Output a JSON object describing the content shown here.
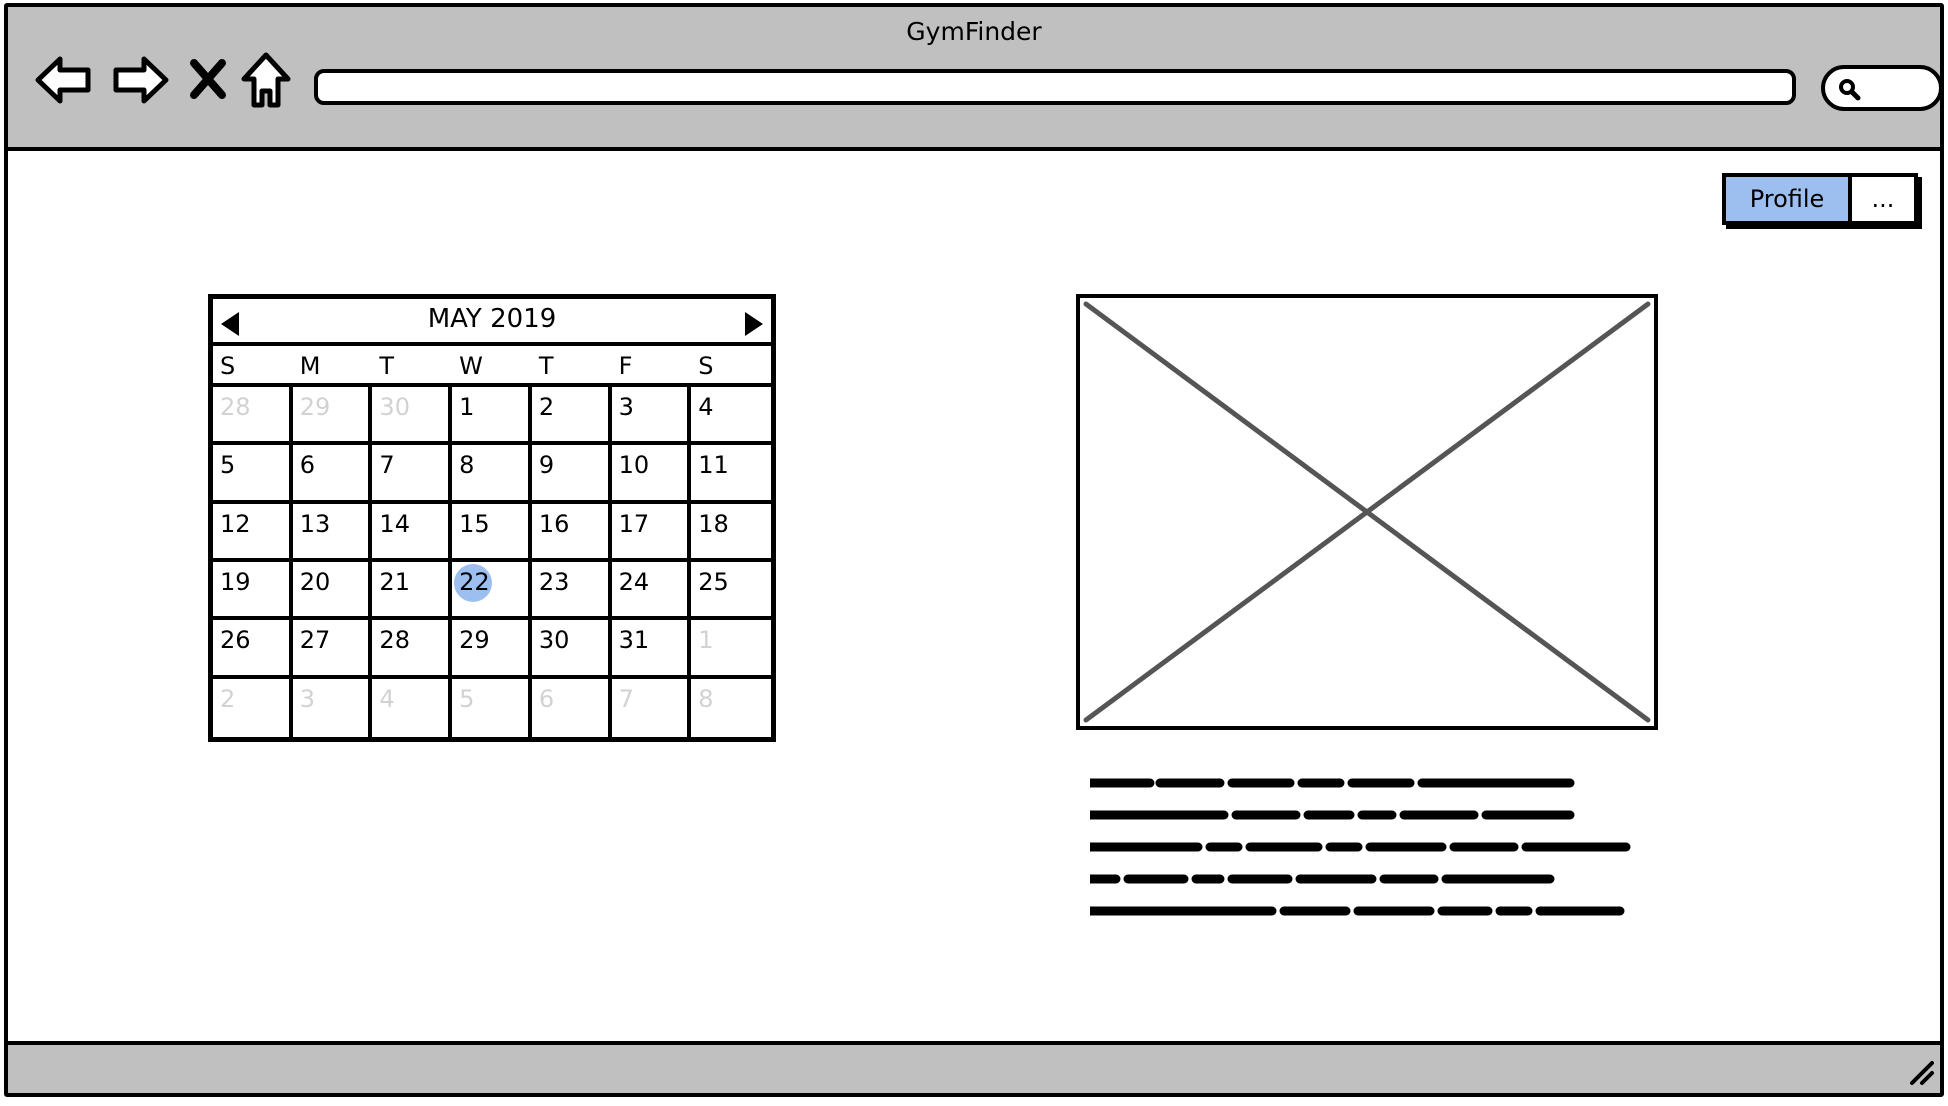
{
  "window": {
    "title": "GymFinder"
  },
  "toolbar": {
    "back_icon": "back-arrow-icon",
    "forward_icon": "forward-arrow-icon",
    "stop_icon": "close-icon",
    "home_icon": "home-icon",
    "url_value": "",
    "search_icon": "search-icon"
  },
  "header": {
    "profile_label": "Profile",
    "more_label": "..."
  },
  "calendar": {
    "month_label": "MAY 2019",
    "weekdays": [
      "S",
      "M",
      "T",
      "W",
      "T",
      "F",
      "S"
    ],
    "days": [
      {
        "n": "28",
        "muted": true
      },
      {
        "n": "29",
        "muted": true
      },
      {
        "n": "30",
        "muted": true
      },
      {
        "n": "1"
      },
      {
        "n": "2"
      },
      {
        "n": "3"
      },
      {
        "n": "4"
      },
      {
        "n": "5"
      },
      {
        "n": "6"
      },
      {
        "n": "7"
      },
      {
        "n": "8"
      },
      {
        "n": "9"
      },
      {
        "n": "10"
      },
      {
        "n": "11"
      },
      {
        "n": "12"
      },
      {
        "n": "13"
      },
      {
        "n": "14"
      },
      {
        "n": "15"
      },
      {
        "n": "16"
      },
      {
        "n": "17"
      },
      {
        "n": "18"
      },
      {
        "n": "19"
      },
      {
        "n": "20"
      },
      {
        "n": "21"
      },
      {
        "n": "22",
        "selected": true
      },
      {
        "n": "23"
      },
      {
        "n": "24"
      },
      {
        "n": "25"
      },
      {
        "n": "26"
      },
      {
        "n": "27"
      },
      {
        "n": "28"
      },
      {
        "n": "29"
      },
      {
        "n": "30"
      },
      {
        "n": "31"
      },
      {
        "n": "1",
        "muted": true
      },
      {
        "n": "2",
        "muted": true
      },
      {
        "n": "3",
        "muted": true
      },
      {
        "n": "4",
        "muted": true
      },
      {
        "n": "5",
        "muted": true
      },
      {
        "n": "6",
        "muted": true
      },
      {
        "n": "7",
        "muted": true
      },
      {
        "n": "8",
        "muted": true
      }
    ],
    "selected_color": "#9dbff0",
    "muted_color": "#d2d2d2"
  },
  "colors": {
    "chrome": "#c0c0c0",
    "accent": "#9dbff0",
    "placeholder_cross": "#555555"
  }
}
